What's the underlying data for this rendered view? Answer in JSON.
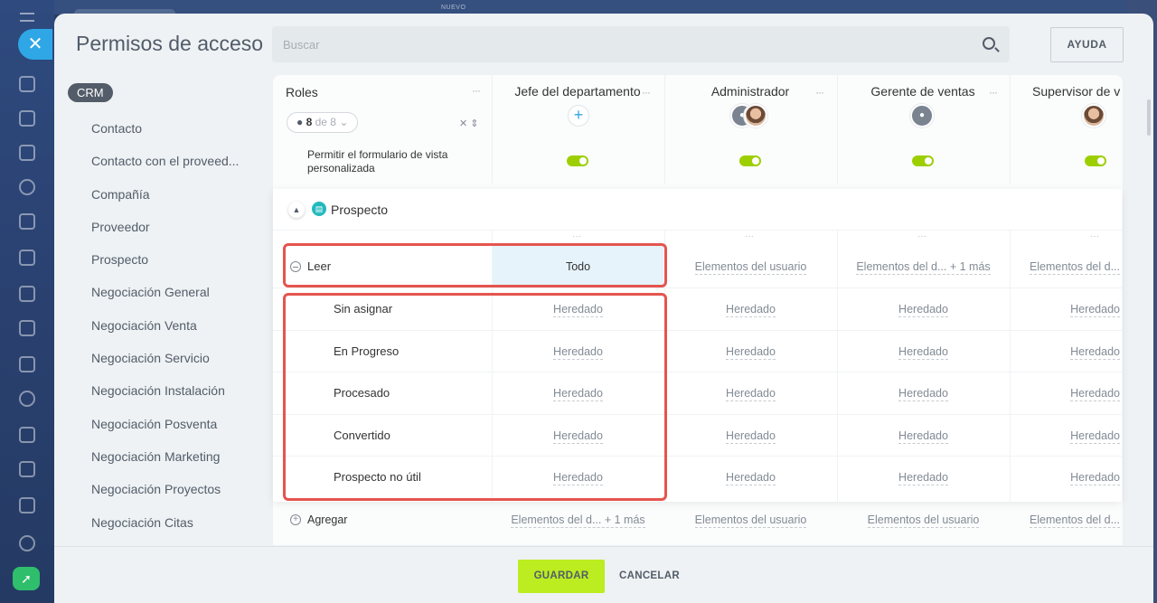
{
  "top_hint": {
    "badge": "NUEVO"
  },
  "header": {
    "title": "Permisos de acceso",
    "search_placeholder": "Buscar",
    "help_label": "AYUDA"
  },
  "sidebar": {
    "section": "CRM",
    "items": [
      "Contacto",
      "Contacto con el proveed...",
      "Compañía",
      "Proveedor",
      "Prospecto",
      "Negociación General",
      "Negociación Venta",
      "Negociación Servicio",
      "Negociación Instalación",
      "Negociación Posventa",
      "Negociación Marketing",
      "Negociación Proyectos",
      "Negociación Citas"
    ]
  },
  "table": {
    "roles_label": "Roles",
    "dots": "···",
    "counter": {
      "shown": "8",
      "of_label": "de 8"
    },
    "columns": [
      "Jefe del departamento",
      "Administrador",
      "Gerente de ventas",
      "Supervisor de v"
    ],
    "custom_view_permission": "Permitir el formulario de vista personalizada"
  },
  "section": {
    "title": "Prospecto",
    "read_row": {
      "label": "Leer",
      "values": [
        "Todo",
        "Elementos del usuario",
        "Elementos del d... + 1 más",
        "Elementos del d..."
      ]
    },
    "stage_rows": [
      {
        "label": "Sin asignar",
        "values": [
          "Heredado",
          "Heredado",
          "Heredado",
          "Heredado"
        ]
      },
      {
        "label": "En Progreso",
        "values": [
          "Heredado",
          "Heredado",
          "Heredado",
          "Heredado"
        ]
      },
      {
        "label": "Procesado",
        "values": [
          "Heredado",
          "Heredado",
          "Heredado",
          "Heredado"
        ]
      },
      {
        "label": "Convertido",
        "values": [
          "Heredado",
          "Heredado",
          "Heredado",
          "Heredado"
        ]
      },
      {
        "label": "Prospecto no útil",
        "values": [
          "Heredado",
          "Heredado",
          "Heredado",
          "Heredado"
        ]
      }
    ]
  },
  "add_row": {
    "label": "Agregar",
    "values": [
      "Elementos del d... + 1 más",
      "Elementos del usuario",
      "Elementos del usuario",
      "Elementos del d..."
    ]
  },
  "footer": {
    "save_label": "GUARDAR",
    "cancel_label": "CANCELAR"
  },
  "colors": {
    "accent": "#2fa7e6",
    "save": "#bbed21",
    "toggle": "#9dcf00",
    "highlight": "#e5544e"
  }
}
